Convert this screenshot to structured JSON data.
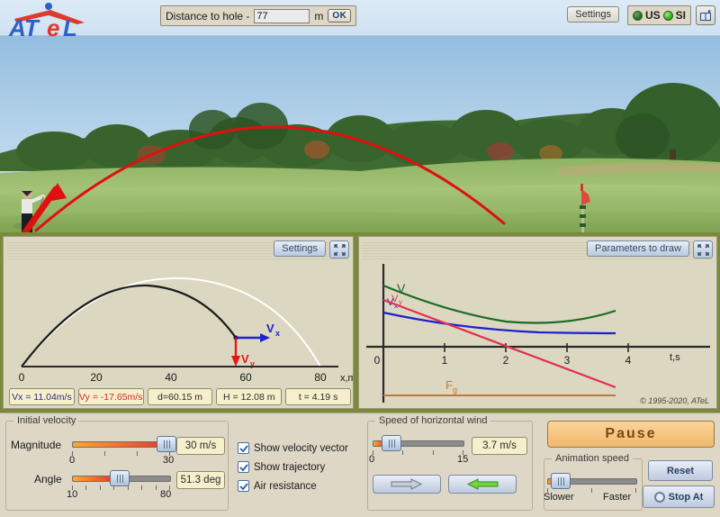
{
  "app": {
    "logo_text": "ATeL"
  },
  "topbar": {
    "distance_label": "Distance to hole -",
    "distance_value": "77",
    "distance_unit": "m",
    "ok_label": "OK",
    "settings_label": "Settings",
    "unit_us": "US",
    "unit_si": "SI",
    "unit_selected": "SI"
  },
  "left_panel": {
    "settings_label": "Settings",
    "vx_box": "Vx = 11.04m/s",
    "vy_box": "Vy = -17.65m/s",
    "d_box": "d=60.15 m",
    "h_box": "H = 12.08 m",
    "t_box": "t = 4.19 s",
    "vx_arrow_label": "Vx",
    "vy_arrow_label": "Vy"
  },
  "right_panel": {
    "params_label": "Parameters to draw",
    "copyright": "© 1995-2020, ATeL"
  },
  "controls": {
    "initial_velocity_title": "Initial velocity",
    "magnitude_label": "Magnitude",
    "magnitude_value": "30 m/s",
    "magnitude_min": "0",
    "magnitude_max": "30",
    "angle_label": "Angle",
    "angle_value": "51.3 deg",
    "angle_min": "10",
    "angle_max": "80",
    "cb_velocity_vector": "Show velocity vector",
    "cb_trajectory": "Show trajectory",
    "cb_air_resistance": "Air resistance",
    "wind_title": "Speed of horizontal wind",
    "wind_value": "3.7 m/s",
    "wind_min": "0",
    "wind_max": "15",
    "pause_label": "Pause",
    "anim_title": "Animation speed",
    "anim_slower": "Slower",
    "anim_faster": "Faster",
    "reset_label": "Reset",
    "stopat_label": "Stop At"
  },
  "chart_data": [
    {
      "type": "line",
      "title": "",
      "xlabel": "x,m",
      "ylabel": "",
      "xlim": [
        0,
        90
      ],
      "ylim": [
        0,
        16
      ],
      "xticks": [
        0,
        20,
        40,
        60,
        80
      ],
      "xticklabels": [
        "0",
        "20",
        "40",
        "60",
        "80"
      ],
      "grid": false,
      "legend": "none",
      "series": [
        {
          "name": "trajectory-with-air-resistance",
          "color": "#1c1c1c",
          "x": [
            0,
            5,
            10,
            15,
            20,
            25,
            30,
            35,
            40,
            45,
            50,
            55,
            60.15
          ],
          "y": [
            0,
            4.1,
            7.3,
            9.7,
            11.3,
            12.0,
            12.08,
            11.6,
            10.5,
            8.9,
            6.8,
            4.1,
            0.9
          ]
        },
        {
          "name": "trajectory-no-air-resistance",
          "color": "#ffffff",
          "x": [
            0,
            7,
            14,
            21,
            28,
            35,
            42,
            49,
            56,
            63,
            70,
            77,
            84
          ],
          "y": [
            0,
            5.9,
            10.2,
            13.0,
            14.4,
            14.5,
            13.2,
            11.0,
            8.0,
            5.2,
            3.0,
            1.2,
            0
          ]
        }
      ],
      "annotations": [
        {
          "name": "ball-marker",
          "x": 60.15,
          "y": 0.9
        },
        {
          "name": "vx-vector",
          "label": "Vx",
          "color": "#2020d0",
          "direction": "right"
        },
        {
          "name": "vy-vector",
          "label": "Vy",
          "color": "#e01818",
          "direction": "down"
        }
      ]
    },
    {
      "type": "line",
      "title": "",
      "xlabel": "t,s",
      "ylabel": "",
      "xlim": [
        0,
        4.6
      ],
      "ylim": [
        -26,
        32
      ],
      "xticks": [
        0,
        1,
        2,
        3,
        4
      ],
      "xticklabels": [
        "0",
        "1",
        "2",
        "3",
        "4"
      ],
      "grid": false,
      "legend": "inline-labels",
      "series": [
        {
          "name": "V",
          "label": "V",
          "color": "#1a6b2a",
          "x": [
            0,
            0.5,
            1.0,
            1.5,
            2.0,
            2.5,
            3.0,
            3.5,
            3.7
          ],
          "y": [
            30.0,
            25.3,
            21.6,
            18.9,
            17.3,
            17.0,
            18.2,
            20.8,
            22.0
          ]
        },
        {
          "name": "Vx",
          "label": "Vx",
          "color": "#2020d0",
          "x": [
            0,
            0.5,
            1.0,
            1.5,
            2.0,
            2.5,
            3.0,
            3.5,
            3.7
          ],
          "y": [
            18.8,
            16.0,
            14.2,
            12.9,
            12.0,
            11.5,
            11.2,
            11.05,
            11.04
          ]
        },
        {
          "name": "Vy",
          "label": "Vy",
          "color": "#e0304f",
          "x": [
            0,
            0.5,
            1.0,
            1.5,
            2.0,
            2.5,
            3.0,
            3.5,
            3.7
          ],
          "y": [
            23.4,
            17.0,
            10.8,
            5.0,
            -0.4,
            -5.5,
            -10.3,
            -14.9,
            -16.8
          ]
        },
        {
          "name": "Fg",
          "label": "Fg",
          "color": "#c07838",
          "x": [
            0,
            3.7
          ],
          "y": [
            -22.0,
            -22.0
          ]
        }
      ]
    }
  ]
}
